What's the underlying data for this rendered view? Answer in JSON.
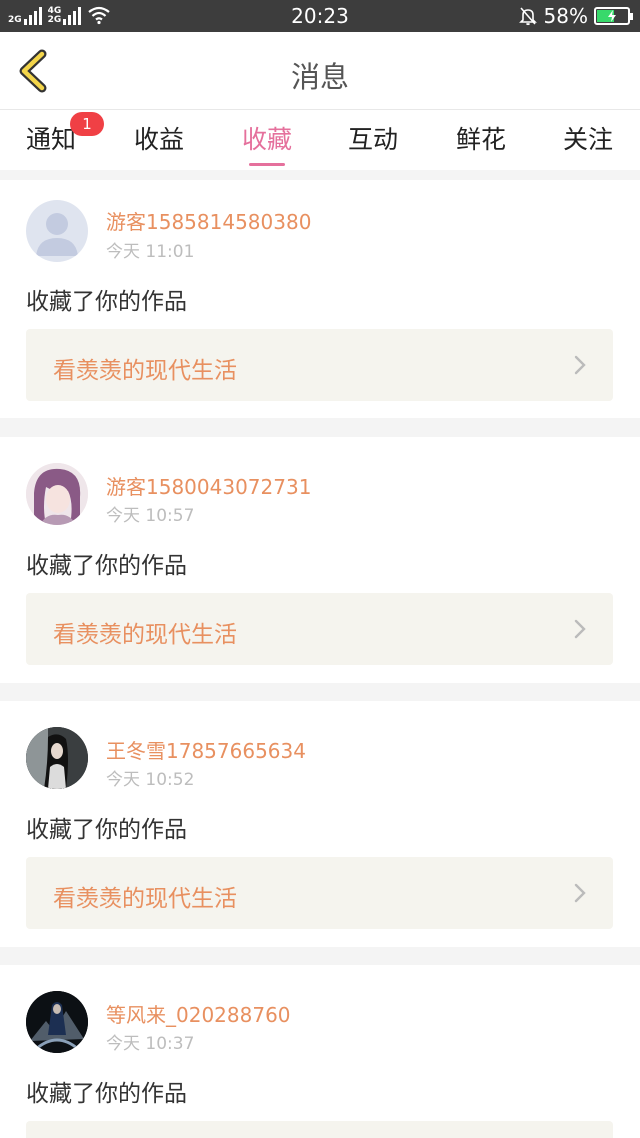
{
  "status_bar": {
    "net1": "2G",
    "net2": "4G",
    "net3": "2G",
    "time": "20:23",
    "battery_text": "58%",
    "battery_level": 0.58,
    "icons": [
      "signal-icon",
      "wifi-icon",
      "mute-bell-icon",
      "battery-icon"
    ]
  },
  "header": {
    "title": "消息",
    "back_icon": "chevron-left-icon"
  },
  "tabs": [
    {
      "label": "通知",
      "badge": "1"
    },
    {
      "label": "收益"
    },
    {
      "label": "收藏",
      "active": true
    },
    {
      "label": "互动"
    },
    {
      "label": "鲜花"
    },
    {
      "label": "关注"
    }
  ],
  "messages": [
    {
      "user": "游客1585814580380",
      "time": "今天 11:01",
      "action": "收藏了你的作品",
      "work": "看羡羡的现代生活"
    },
    {
      "user": "游客1580043072731",
      "time": "今天 10:57",
      "action": "收藏了你的作品",
      "work": "看羡羡的现代生活"
    },
    {
      "user": "王冬雪17857665634",
      "time": "今天 10:52",
      "action": "收藏了你的作品",
      "work": "看羡羡的现代生活"
    },
    {
      "user": "等风来_020288760",
      "time": "今天 10:37",
      "action": "收藏了你的作品",
      "work": ""
    }
  ],
  "colors": {
    "accent_pink": "#e5709c",
    "username_orange": "#e89060",
    "badge_red": "#f04045",
    "status_bar_bg": "#3d3d3d"
  }
}
